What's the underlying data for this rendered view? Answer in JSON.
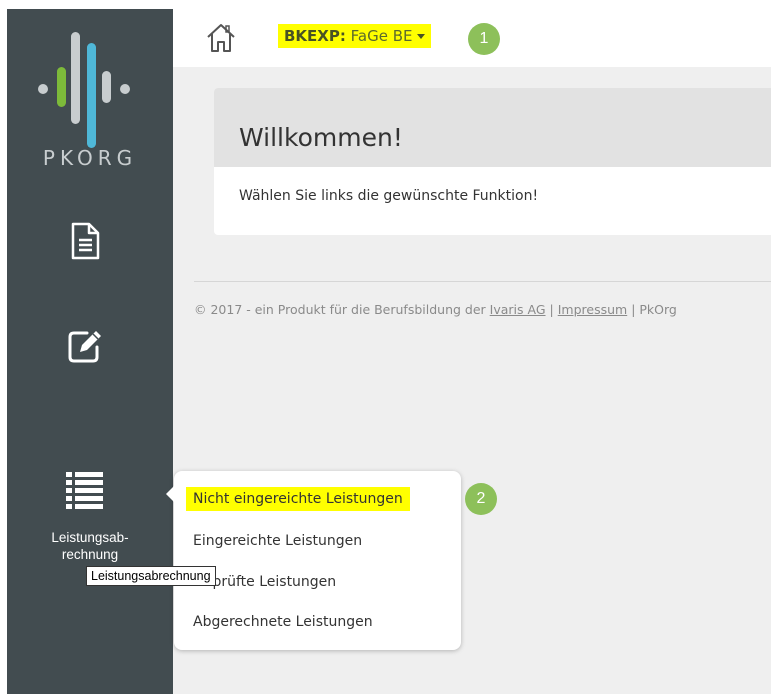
{
  "logo": {
    "text": "PKORG"
  },
  "sidebar": {
    "items": [
      {
        "icon": "document-icon",
        "label": ""
      },
      {
        "icon": "edit-icon",
        "label": ""
      },
      {
        "icon": "list-icon",
        "label": "Leistungsab-\nrechnung"
      }
    ]
  },
  "header": {
    "home_icon": "home-icon",
    "org_code": "BKEXP:",
    "org_name": "FaGe BE"
  },
  "badges": {
    "first": "1",
    "second": "2"
  },
  "welcome": {
    "title": "Willkommen!",
    "text": "Wählen Sie links die gewünschte Funktion!"
  },
  "footer": {
    "prefix": "© 2017 - ein Produkt für die Berufsbildung der",
    "company_link": "Ivaris AG",
    "separator": "|",
    "imprint_link": "Impressum",
    "product": "PkOrg"
  },
  "submenu": {
    "items": [
      "Nicht eingereichte Leistungen",
      "Eingereichte Leistungen",
      "Geprüfte Leistungen",
      "Abgerechnete Leistungen"
    ]
  },
  "tooltip": {
    "text": "Leistungsabrechnung"
  },
  "colors": {
    "sidebar": "#424c50",
    "highlight": "#ffff00",
    "badge": "#8dc05a",
    "logo_green": "#7dba3a",
    "logo_blue": "#4fb8d8"
  }
}
